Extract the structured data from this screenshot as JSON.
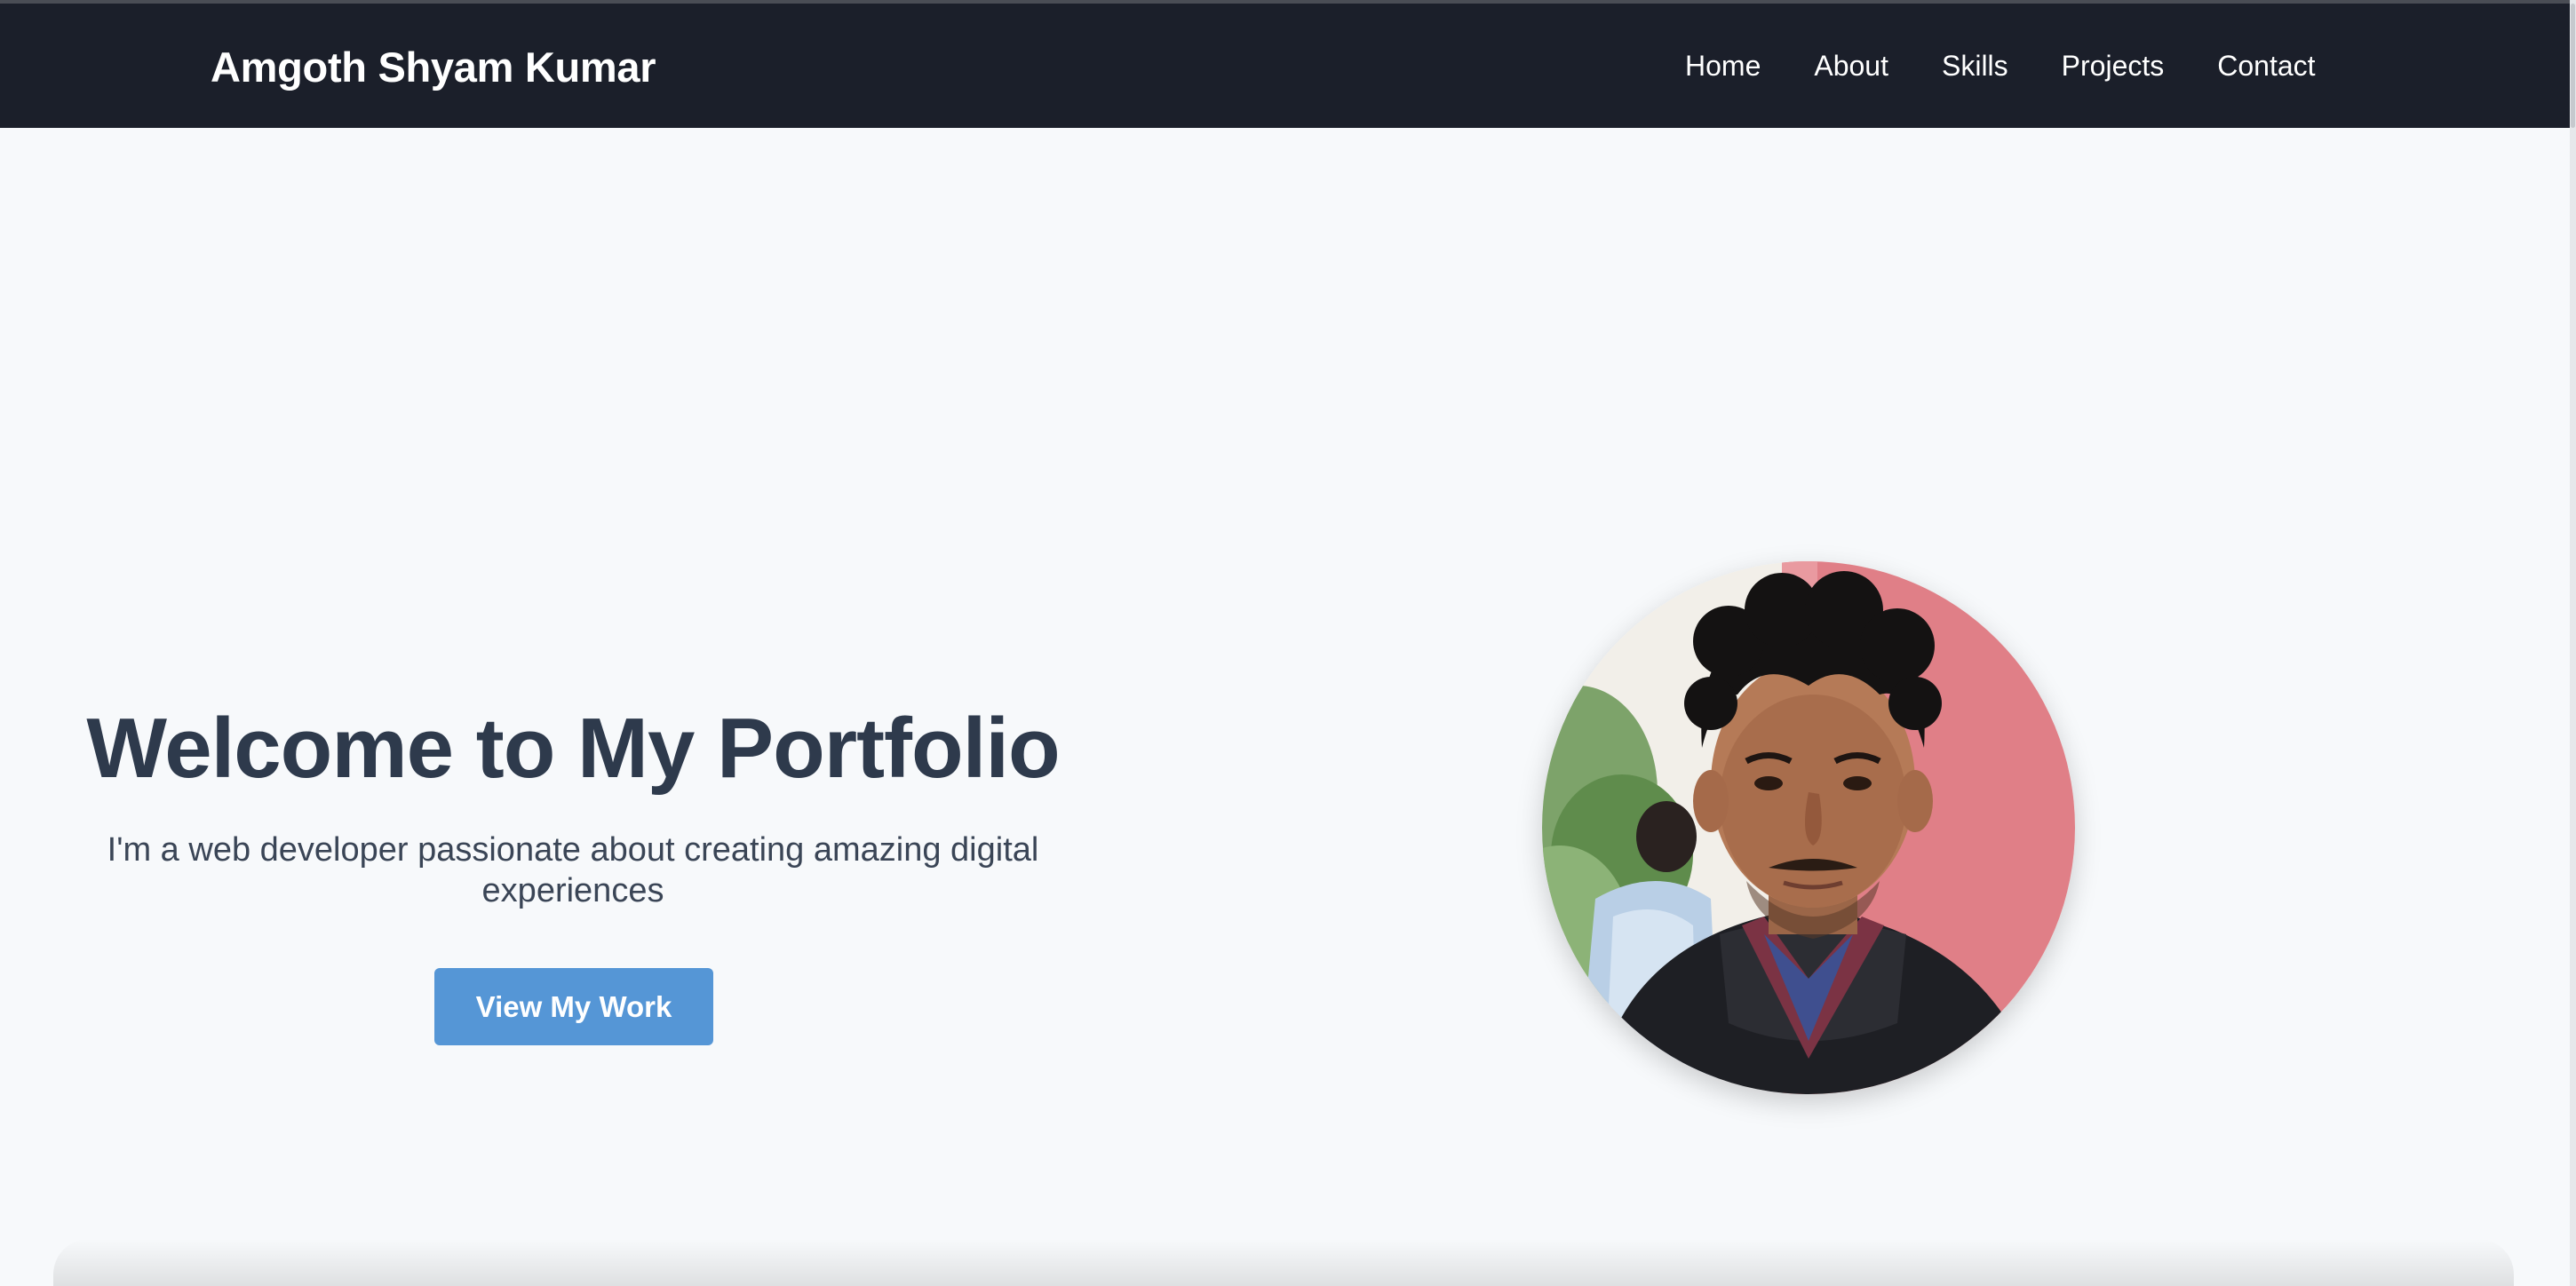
{
  "header": {
    "brand": "Amgoth Shyam Kumar",
    "nav": [
      "Home",
      "About",
      "Skills",
      "Projects",
      "Contact"
    ]
  },
  "hero": {
    "title": "Welcome to My Portfolio",
    "subtitle": "I'm a web developer passionate about creating amazing digital experiences",
    "cta_label": "View My Work"
  },
  "colors": {
    "navbar_bg": "#1b1f2a",
    "page_bg": "#f7f9fb",
    "accent": "#5596d6",
    "heading": "#2e3a4c"
  }
}
